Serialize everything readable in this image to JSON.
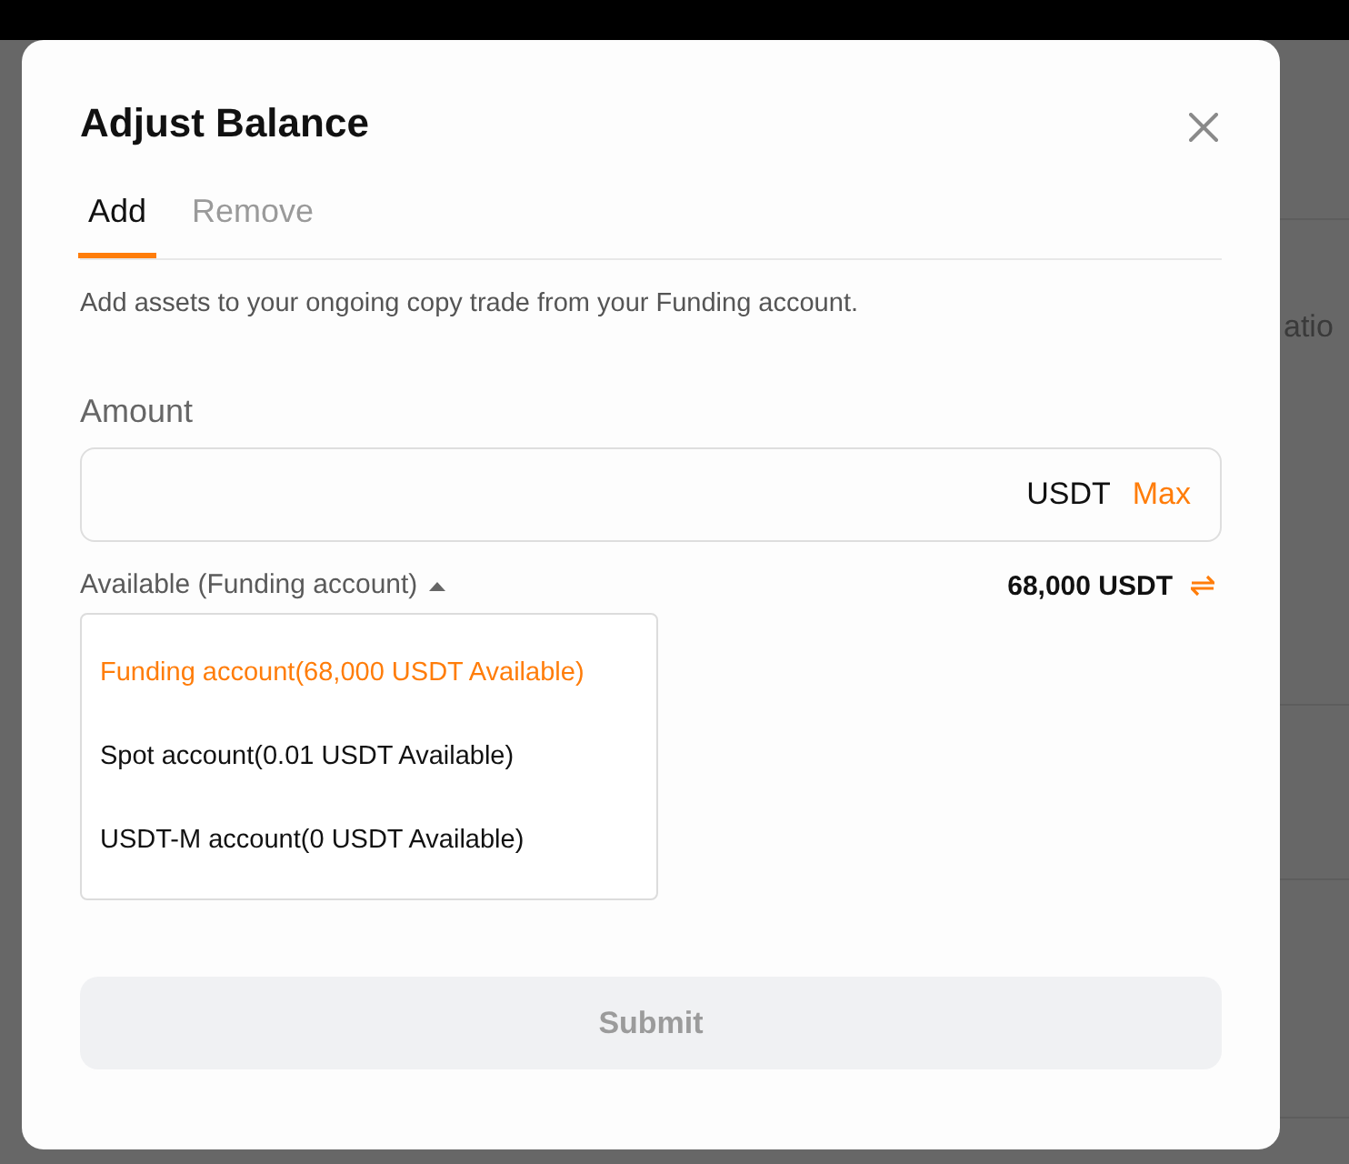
{
  "background": {
    "page_text": "atio"
  },
  "dialog": {
    "title": "Adjust Balance",
    "tabs": [
      {
        "label": "Add",
        "selected": true
      },
      {
        "label": "Remove",
        "selected": false
      }
    ],
    "description": "Add assets to your ongoing copy trade from your Funding account.",
    "amount": {
      "label": "Amount",
      "unit": "USDT",
      "max": "Max"
    },
    "source": {
      "label": "Available (Funding account)",
      "expanded": true,
      "balance": "68,000 USDT"
    },
    "accounts": [
      {
        "label": "Funding account(68,000 USDT Available)",
        "selected": true
      },
      {
        "label": "Spot account(0.01 USDT Available)",
        "selected": false
      },
      {
        "label": "USDT-M account(0 USDT Available)",
        "selected": false
      }
    ],
    "submit": {
      "label": "Submit",
      "disabled": true
    }
  }
}
